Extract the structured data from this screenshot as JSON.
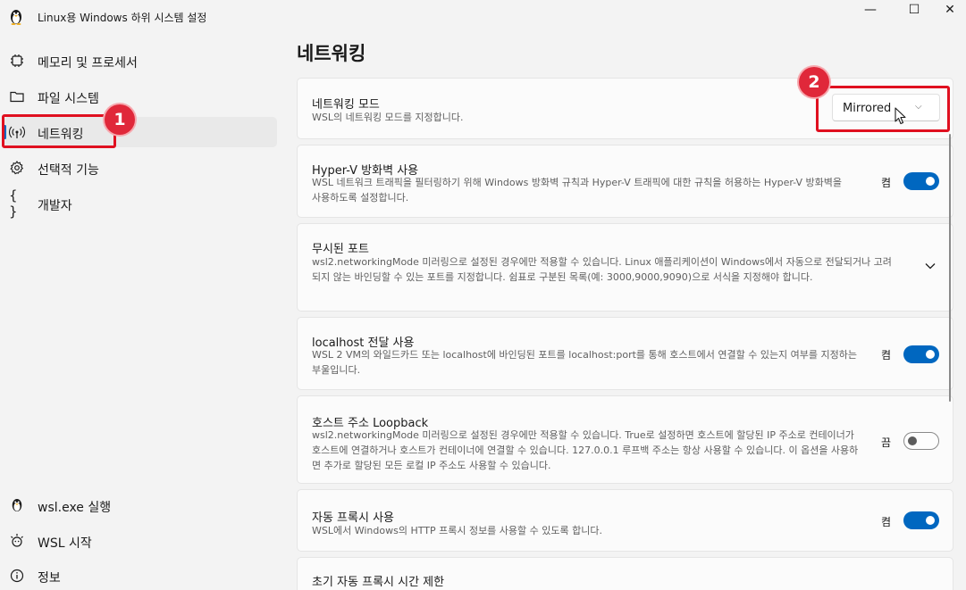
{
  "window": {
    "title": "Linux용 Windows 하위 시스템 설정",
    "minimize_glyph": "—",
    "maximize_glyph": "☐",
    "close_glyph": "✕"
  },
  "sidebar": {
    "items": [
      {
        "label": "메모리 및 프로세서",
        "icon": "chip-icon"
      },
      {
        "label": "파일 시스템",
        "icon": "folder-icon"
      },
      {
        "label": "네트워킹",
        "icon": "antenna-icon",
        "active": true
      },
      {
        "label": "선택적 기능",
        "icon": "gear-icon"
      },
      {
        "label": "개발자",
        "icon": "braces-icon"
      }
    ],
    "footer_items": [
      {
        "label": "wsl.exe 실행",
        "icon": "penguin-icon"
      },
      {
        "label": "WSL 시작",
        "icon": "sparkle-icon"
      },
      {
        "label": "정보",
        "icon": "info-icon"
      }
    ]
  },
  "main": {
    "title": "네트워킹",
    "cards": {
      "networking_mode": {
        "title": "네트워킹 모드",
        "description": "WSL의 네트워킹 모드를 지정합니다.",
        "dropdown_value": "Mirrored"
      },
      "hyperv_firewall": {
        "title": "Hyper-V 방화벽 사용",
        "description": "WSL 네트워크 트래픽을 필터링하기 위해 Windows 방화벽 규칙과 Hyper-V 트래픽에 대한 규칙을 허용하는 Hyper-V 방화벽을 사용하도록 설정합니다.",
        "state_label": "켬",
        "on": true
      },
      "ignored_ports": {
        "title": "무시된 포트",
        "description": "wsl2.networkingMode 미러링으로 설정된 경우에만 적용할 수 있습니다. Linux 애플리케이션이 Windows에서 자동으로 전달되거나 고려되지 않는 바인딩할 수 있는 포트를 지정합니다. 쉼표로 구분된 목록(예: 3000,9000,9090)으로 서식을 지정해야 합니다."
      },
      "localhost_forwarding": {
        "title": "localhost 전달 사용",
        "description": "WSL 2 VM의 와일드카드 또는 localhost에 바인딩된 포트를 localhost:port를 통해 호스트에서 연결할 수 있는지 여부를 지정하는 부울입니다.",
        "state_label": "켬",
        "on": true
      },
      "host_loopback": {
        "title": "호스트 주소 Loopback",
        "description": "wsl2.networkingMode 미러링으로 설정된 경우에만 적용할 수 있습니다. True로 설정하면 호스트에 할당된 IP 주소로 컨테이너가 호스트에 연결하거나 호스트가 컨테이너에 연결할 수 있습니다. 127.0.0.1 루프백 주소는 항상 사용할 수 있습니다. 이 옵션을 사용하면 추가로 할당된 모든 로컬 IP 주소도 사용할 수 있습니다.",
        "state_label": "끔",
        "on": false
      },
      "auto_proxy": {
        "title": "자동 프록시 사용",
        "description": "WSL에서 Windows의 HTTP 프록시 정보를 사용할 수 있도록 합니다.",
        "state_label": "켬",
        "on": true
      },
      "initial_proxy_timeout": {
        "title": "초기 자동 프록시 시간 제한"
      }
    }
  },
  "annotations": {
    "badge1": "1",
    "badge2": "2"
  },
  "colors": {
    "accent": "#0067c0",
    "highlight": "#e01020",
    "badge": "#e0283a"
  }
}
